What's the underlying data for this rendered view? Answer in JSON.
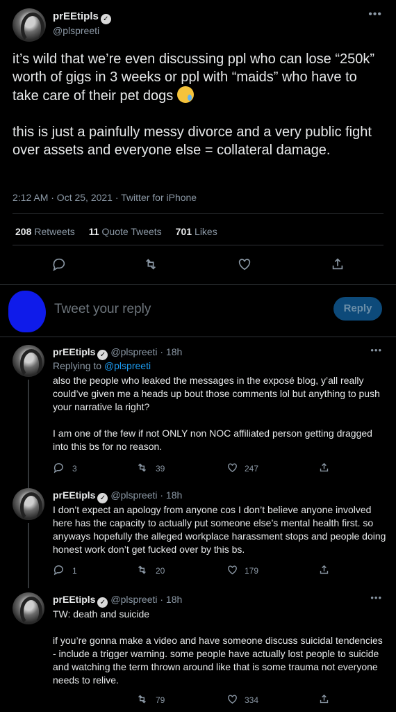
{
  "main_tweet": {
    "display_name": "prEEtipls",
    "handle": "@plspreeti",
    "text": "it’s wild that we’re even discussing ppl who can lose “250k” worth of gigs in 3 weeks or ppl with “maids” who have to take care of their pet dogs ",
    "text2": "this is just a painfully messy divorce and a very public fight over assets and everyone else = collateral damage.",
    "timestamp": "2:12 AM · Oct 25, 2021 · Twitter for iPhone",
    "retweets": "208",
    "retweets_label": "Retweets",
    "quote_tweets": "11",
    "quote_tweets_label": "Quote Tweets",
    "likes": "701",
    "likes_label": "Likes"
  },
  "reply_box": {
    "placeholder": "Tweet your reply",
    "button_label": "Reply"
  },
  "replies": [
    {
      "display_name": "prEEtipls",
      "handle": "@plspreeti · 18h",
      "replying_prefix": "Replying to ",
      "replying_to": "@plspreeti",
      "text": "also the people who leaked the messages in the exposé blog, y’all really could’ve given me a heads up bout those comments lol but anything to push your narrative la right?\n\nI am one of the few if not ONLY non NOC affiliated person getting dragged into this bs for no reason.",
      "replies": "3",
      "retweets": "39",
      "likes": "247"
    },
    {
      "display_name": "prEEtipls",
      "handle": "@plspreeti · 18h",
      "text": "I don’t expect an apology from anyone cos I don’t believe anyone involved here has the capacity to actually put someone else’s mental health first. so anyways hopefully the alleged workplace harassment stops and people doing honest work don’t get fucked over by this bs.",
      "replies": "1",
      "retweets": "20",
      "likes": "179"
    },
    {
      "display_name": "prEEtipls",
      "handle": "@plspreeti · 18h",
      "text": "TW: death and suicide\n\nif you’re gonna make a video and have someone discuss suicidal tendencies - include a trigger warning. some people have actually lost people to suicide and watching the term thrown around like that is some trauma not everyone needs to relive.",
      "retweets": "79",
      "likes": "334"
    }
  ],
  "icons": {
    "reply": "reply-icon",
    "retweet": "retweet-icon",
    "like": "heart-icon",
    "share": "share-icon",
    "more": "more-icon",
    "verified": "verified-badge-icon",
    "emoji": "smiling-face-with-tear-emoji"
  }
}
